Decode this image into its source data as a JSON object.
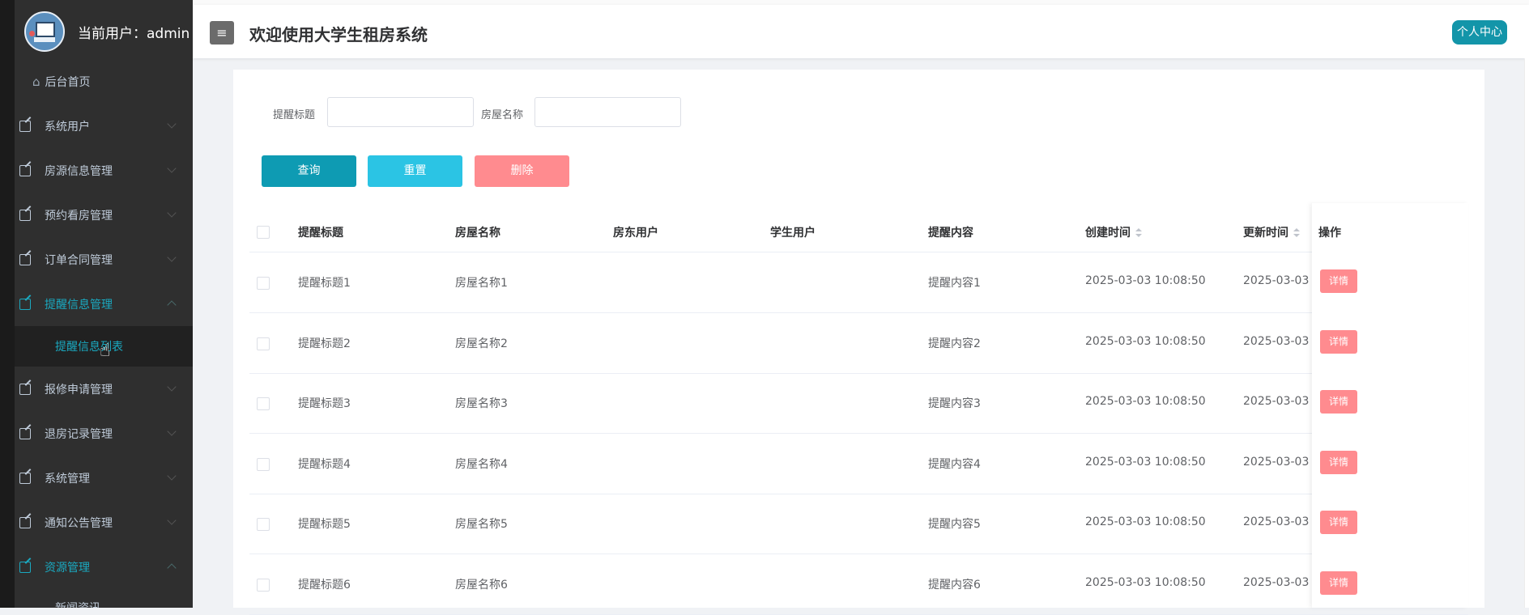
{
  "header": {
    "title": "欢迎使用大学生租房系统",
    "menu_icon": "≡",
    "personal_center": "个人中心"
  },
  "sidebar": {
    "user_label": "当前用户：admin",
    "home": "后台首页",
    "items": [
      {
        "label": "系统用户"
      },
      {
        "label": "房源信息管理"
      },
      {
        "label": "预约看房管理"
      },
      {
        "label": "订单合同管理"
      },
      {
        "label": "提醒信息管理",
        "active": true,
        "sub": "提醒信息列表"
      },
      {
        "label": "报修申请管理"
      },
      {
        "label": "退房记录管理"
      },
      {
        "label": "系统管理"
      },
      {
        "label": "通知公告管理"
      },
      {
        "label": "资源管理",
        "active": true,
        "sub": "新闻资讯"
      }
    ]
  },
  "search": {
    "title_label": "提醒标题",
    "title_value": "",
    "house_label": "房屋名称",
    "house_value": ""
  },
  "buttons": {
    "query": "查询",
    "reset": "重置",
    "delete": "删除"
  },
  "table": {
    "columns": [
      "提醒标题",
      "房屋名称",
      "房东用户",
      "学生用户",
      "提醒内容",
      "创建时间",
      "更新时间",
      "操作"
    ],
    "action_label": "详情",
    "rows": [
      {
        "title": "提醒标题1",
        "house": "房屋名称1",
        "landlord": "",
        "student": "",
        "content": "提醒内容1",
        "created": "2025-03-03 10:08:50",
        "updated": "2025-03-03"
      },
      {
        "title": "提醒标题2",
        "house": "房屋名称2",
        "landlord": "",
        "student": "",
        "content": "提醒内容2",
        "created": "2025-03-03 10:08:50",
        "updated": "2025-03-03"
      },
      {
        "title": "提醒标题3",
        "house": "房屋名称3",
        "landlord": "",
        "student": "",
        "content": "提醒内容3",
        "created": "2025-03-03 10:08:50",
        "updated": "2025-03-03"
      },
      {
        "title": "提醒标题4",
        "house": "房屋名称4",
        "landlord": "",
        "student": "",
        "content": "提醒内容4",
        "created": "2025-03-03 10:08:50",
        "updated": "2025-03-03"
      },
      {
        "title": "提醒标题5",
        "house": "房屋名称5",
        "landlord": "",
        "student": "",
        "content": "提醒内容5",
        "created": "2025-03-03 10:08:50",
        "updated": "2025-03-03"
      },
      {
        "title": "提醒标题6",
        "house": "房屋名称6",
        "landlord": "",
        "student": "",
        "content": "提醒内容6",
        "created": "2025-03-03 10:08:50",
        "updated": "2025-03-03"
      }
    ]
  },
  "colors": {
    "accent": "#0e9bb3",
    "reset": "#2bc4e4",
    "danger": "#ff8b8f",
    "sidebar_bg": "#2f2f2f",
    "active_text": "#1aa9c0"
  }
}
